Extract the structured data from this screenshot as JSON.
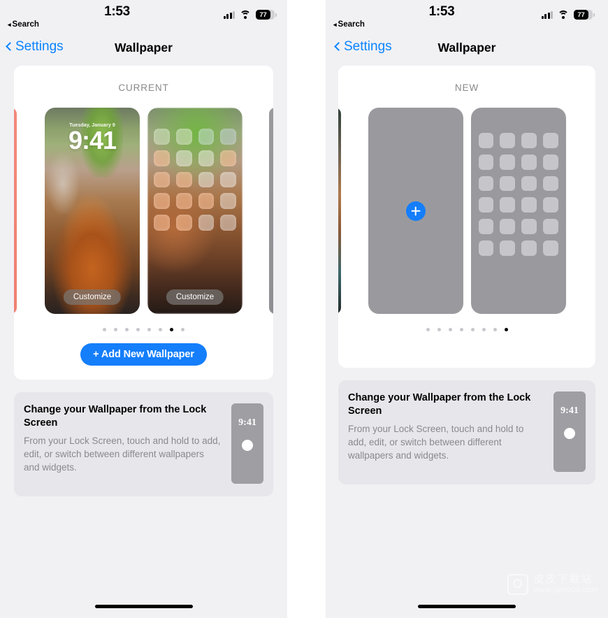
{
  "meta": {
    "screen_title": "Wallpaper"
  },
  "status_bar": {
    "time": "1:53",
    "back_app": "Search",
    "back_arrow": "◂",
    "battery_percent": "77",
    "icons": [
      "cellular-signal-icon",
      "wifi-icon",
      "battery-icon"
    ]
  },
  "nav_bar": {
    "back_label": "Settings",
    "title": "Wallpaper"
  },
  "left_panel": {
    "section_label": "CURRENT",
    "lock_preview": {
      "date": "Tuesday, January 9",
      "time": "9:41",
      "customize_label": "Customize"
    },
    "home_preview": {
      "customize_label": "Customize"
    },
    "pager": {
      "count": 8,
      "active_index": 6
    },
    "add_button_label": "+ Add New Wallpaper"
  },
  "right_panel": {
    "section_label": "NEW",
    "add_wallpaper_icon": "plus-icon",
    "pager": {
      "count": 8,
      "active_index": 7
    }
  },
  "info_card": {
    "title": "Change your Wallpaper from the Lock Screen",
    "body": "From your Lock Screen, touch and hold to add, edit, or switch between different wallpapers and widgets.",
    "thumb_time": "9:41"
  },
  "watermark": {
    "name": "皮皮下载站",
    "url": "www.pp4000.com"
  },
  "colors": {
    "accent_blue": "#147efb",
    "link_blue": "#0a84ff",
    "page_bg": "#f1f1f4",
    "card_bg": "#ffffff",
    "info_bg": "#e6e6eb",
    "placeholder_grey": "#9a9a9e"
  }
}
